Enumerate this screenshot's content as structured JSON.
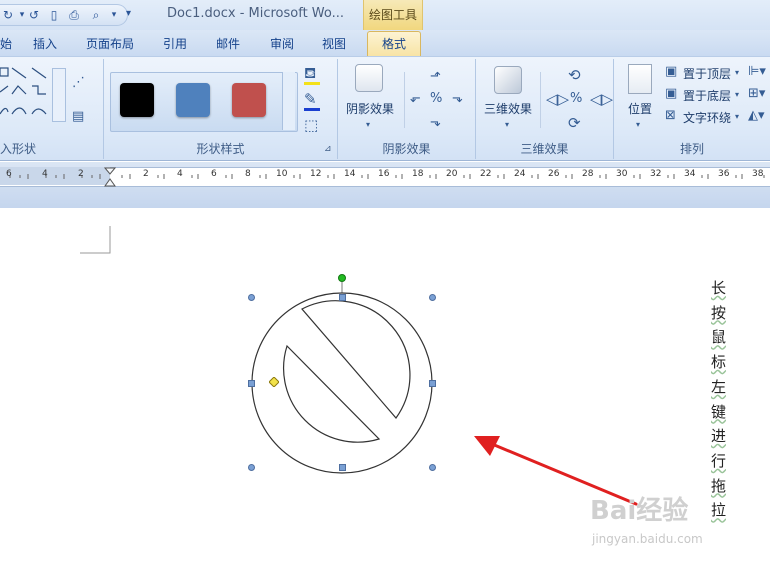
{
  "titlebar": {
    "doc_title": "Doc1.docx - Microsoft Wo...",
    "context_tab_group": "绘图工具"
  },
  "tabs": [
    {
      "label": "始",
      "active": false
    },
    {
      "label": "插入",
      "active": false
    },
    {
      "label": "页面布局",
      "active": false
    },
    {
      "label": "引用",
      "active": false
    },
    {
      "label": "邮件",
      "active": false
    },
    {
      "label": "审阅",
      "active": false
    },
    {
      "label": "视图",
      "active": false
    },
    {
      "label": "格式",
      "active": true
    }
  ],
  "ribbon": {
    "groups": [
      {
        "label": "入形状"
      },
      {
        "label": "形状样式"
      },
      {
        "label": "阴影效果"
      },
      {
        "label": "三维效果"
      },
      {
        "label": "排列"
      }
    ],
    "shape_styles": {
      "swatches": [
        {
          "color": "#000000"
        },
        {
          "color": "#4f81bd"
        },
        {
          "color": "#c0504d"
        }
      ]
    },
    "shadow": {
      "button_label": "阴影效果"
    },
    "threed": {
      "button_label": "三维效果"
    },
    "arrange": {
      "position_label": "位置",
      "bring_to_front": "置于顶层",
      "send_to_back": "置于底层",
      "text_wrap": "文字环绕"
    }
  },
  "ruler": {
    "left_ticks": [
      "6",
      "4",
      "2"
    ],
    "ticks": [
      "2",
      "4",
      "6",
      "8",
      "10",
      "12",
      "14",
      "16",
      "18",
      "20",
      "22",
      "24",
      "26",
      "28",
      "30",
      "32",
      "34",
      "36",
      "38"
    ]
  },
  "document": {
    "vertical_text": [
      "长",
      "按",
      "鼠",
      "标",
      "左",
      "键",
      "进",
      "行",
      "拖",
      "拉"
    ]
  },
  "watermark": {
    "logo": "Bai经验",
    "url": "jingyan.baidu.com"
  },
  "colors": {
    "arrow": "#e02020",
    "handle_blue": "#4f81bd",
    "rotate_handle": "#22bb22",
    "adjust_handle": "#f2e24a"
  }
}
